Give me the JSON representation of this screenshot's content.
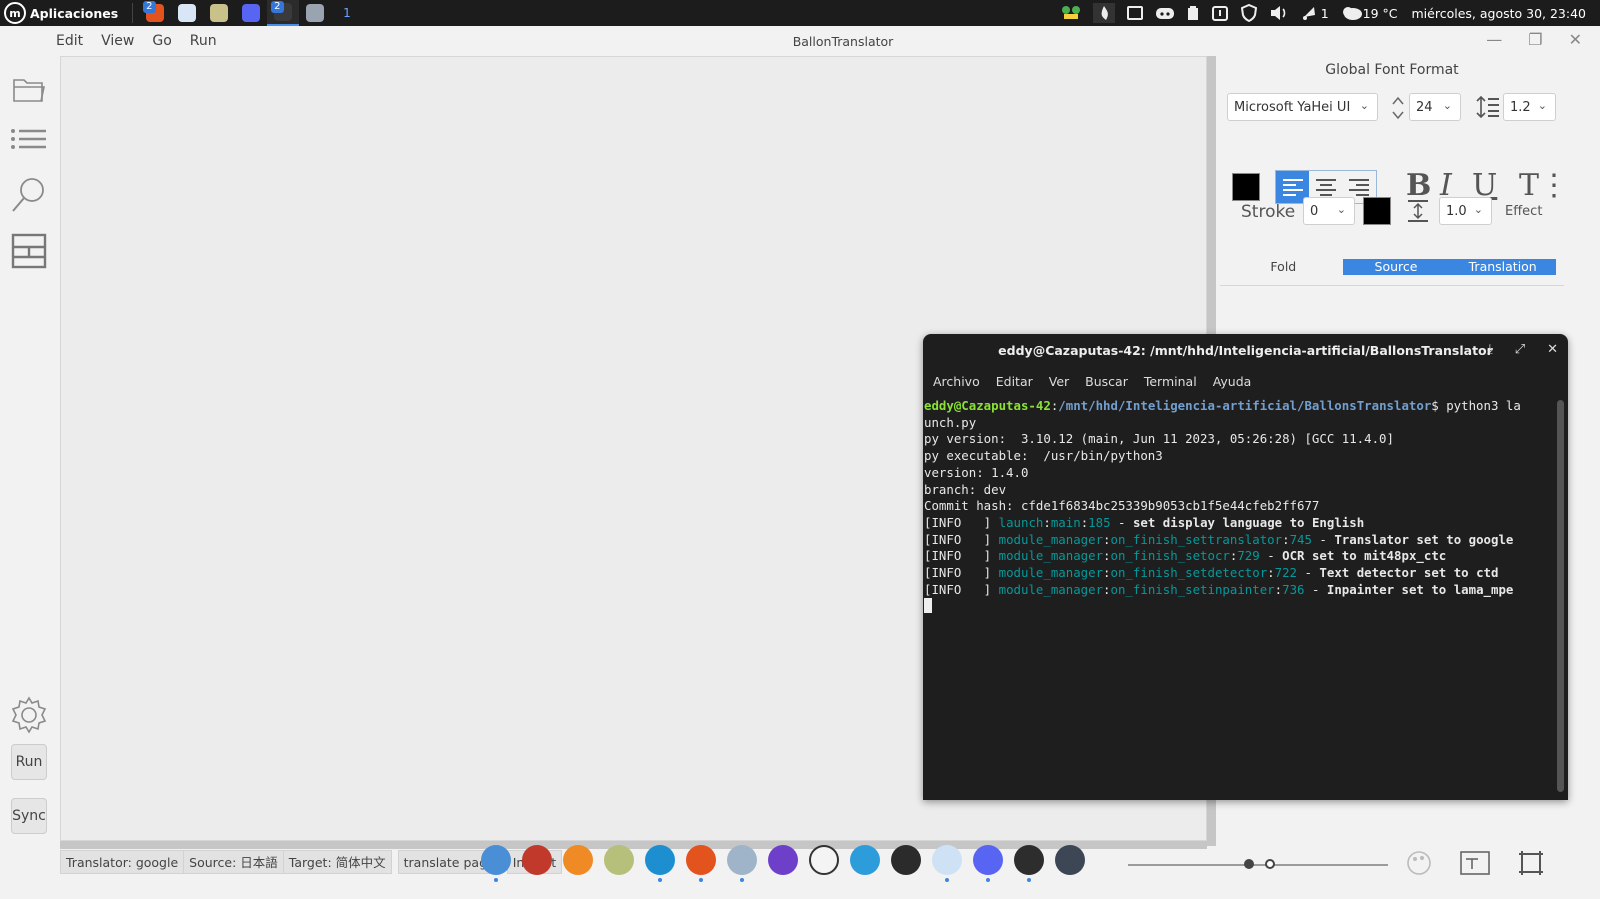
{
  "topbar": {
    "menu_label": "Aplicaciones",
    "apps": [
      {
        "name": "brave-browser-icon",
        "badge": "2",
        "color": "#e2531d"
      },
      {
        "name": "document-viewer-icon",
        "badge": "",
        "color": "#d8e6f5"
      },
      {
        "name": "file-manager-icon",
        "badge": "",
        "color": "#c9c18a"
      },
      {
        "name": "discord-icon",
        "badge": "",
        "color": "#5865f2"
      },
      {
        "name": "terminal-icon",
        "badge": "2",
        "color": "#3a3a3a"
      },
      {
        "name": "settings-gear-icon",
        "badge": "",
        "color": "#9aa4b1"
      }
    ],
    "workspace": "1",
    "tray": {
      "notifications_count": "1",
      "weather": "19 °C",
      "datetime": "miércoles, agosto 30, 23:40"
    }
  },
  "app": {
    "title": "BallonTranslator",
    "menus": [
      "Edit",
      "View",
      "Go",
      "Run"
    ],
    "left_buttons": {
      "run": "Run",
      "sync": "Sync"
    }
  },
  "format_panel": {
    "title": "Global Font Format",
    "font_family": "Microsoft YaHei UI",
    "font_size": "24",
    "line_spacing": "1.2",
    "stroke_label": "Stroke",
    "stroke_value": "0",
    "letter_spacing": "1.0",
    "effect_label": "Effect",
    "font_color": "#000000",
    "stroke_color": "#000000",
    "tabs": [
      "Fold",
      "Source",
      "Translation"
    ]
  },
  "statusbar": {
    "translator": "Translator: google",
    "source": "Source: 日本語",
    "target": "Target: 简体中文",
    "translate_page": "translate page",
    "inpaint": "Inpaint"
  },
  "terminal": {
    "title": "eddy@Cazaputas-42: /mnt/hhd/Inteligencia-artificial/BallonsTranslator",
    "menu": [
      "Archivo",
      "Editar",
      "Ver",
      "Buscar",
      "Terminal",
      "Ayuda"
    ],
    "prompt_user": "eddy@Cazaputas-42",
    "prompt_path": "/mnt/hhd/Inteligencia-artificial/BallonsTranslator",
    "command_line1": "$ python3 la",
    "command_line2": "unch.py",
    "plain_lines": [
      "py version:  3.10.12 (main, Jun 11 2023, 05:26:28) [GCC 11.4.0]",
      "py executable:  /usr/bin/python3",
      "version: 1.4.0",
      "branch: dev",
      "Commit hash: cfde1f6834bc25339b9053cb1f5e44cfeb2ff677"
    ],
    "log_lines": [
      {
        "level": "[INFO   ] ",
        "mod": "launch",
        "fn": "main",
        "line": "185",
        "msg": "set display language to English"
      },
      {
        "level": "[INFO   ] ",
        "mod": "module_manager",
        "fn": "on_finish_settranslator",
        "line": "745",
        "msg": "Translator set to google"
      },
      {
        "level": "[INFO   ] ",
        "mod": "module_manager",
        "fn": "on_finish_setocr",
        "line": "729",
        "msg": "OCR set to mit48px_ctc"
      },
      {
        "level": "[INFO   ] ",
        "mod": "module_manager",
        "fn": "on_finish_setdetector",
        "line": "722",
        "msg": "Text detector set to ctd"
      },
      {
        "level": "[INFO   ] ",
        "mod": "module_manager",
        "fn": "on_finish_setinpainter",
        "line": "736",
        "msg": "Inpainter set to lama_mpe"
      }
    ]
  },
  "dock": [
    {
      "name": "thunderbird-icon",
      "color": "#4a8fd6"
    },
    {
      "name": "screen-recorder-icon",
      "color": "#c0392b"
    },
    {
      "name": "firefox-icon",
      "color": "#f08a24"
    },
    {
      "name": "files-icon",
      "color": "#b7c07a"
    },
    {
      "name": "edge-browser-icon",
      "color": "#1d8fd0"
    },
    {
      "name": "brave-icon",
      "color": "#e2531d"
    },
    {
      "name": "downloads-icon",
      "color": "#9fb4c8"
    },
    {
      "name": "github-icon",
      "color": "#6e40c9"
    },
    {
      "name": "text-editor-icon",
      "color": "#f4f4f4"
    },
    {
      "name": "safari-compass-icon",
      "color": "#2d9cdb"
    },
    {
      "name": "obs-icon",
      "color": "#2b2b2b"
    },
    {
      "name": "reader-icon",
      "color": "#cfe1f4"
    },
    {
      "name": "discord-dock-icon",
      "color": "#5865f2"
    },
    {
      "name": "terminal-dock-icon",
      "color": "#2d2d2d"
    },
    {
      "name": "settings-dock-icon",
      "color": "#3d4654"
    }
  ]
}
